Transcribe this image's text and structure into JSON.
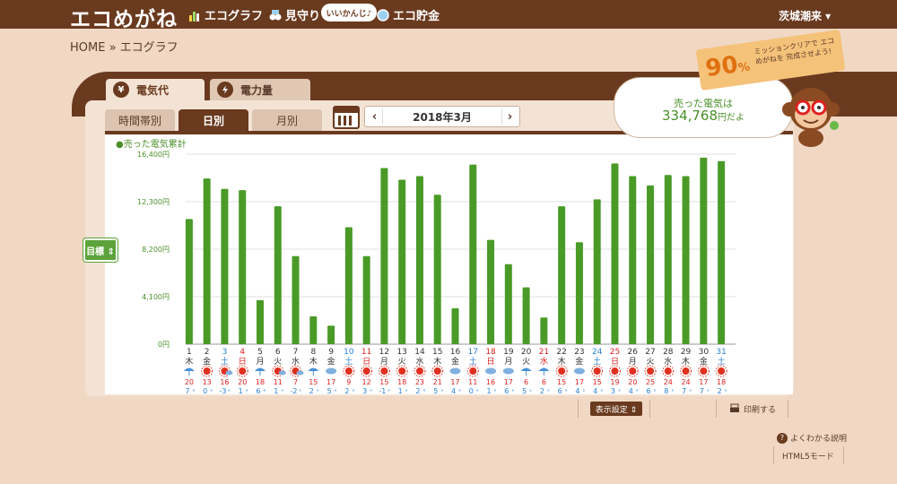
{
  "header": {
    "logo": "エコめがね",
    "nav": [
      {
        "label": "エコグラフ",
        "icon": "bar-chart-icon"
      },
      {
        "label": "見守り",
        "icon": "binoculars-icon"
      },
      {
        "label": "エコ貯金",
        "icon": "coin-icon"
      }
    ],
    "bubble": "いいかんじ♪",
    "user": "茨城潮来 ▾"
  },
  "breadcrumb": "HOME » エコグラフ",
  "tabs": {
    "cost_icon": "¥",
    "cost": "電気代",
    "power": "電力量",
    "hourly": "時間帯別",
    "daily": "日別",
    "monthly": "月別"
  },
  "month_label": "2018年3月",
  "prev_arrow": "‹",
  "next_arrow": "›",
  "sold": {
    "label": "売った電気は",
    "value": "334,768",
    "unit": "円だよ"
  },
  "mission": {
    "percent": "90",
    "percent_sign": "%",
    "message": "ミッションクリアで エコめがねを 完成させよう!"
  },
  "target_btn": "目標 ⇕",
  "display_settings": "表示設定 ⇕",
  "print": "印刷する",
  "help": "よくわかる説明",
  "html5": "HTML5モード",
  "chart_data": {
    "type": "bar",
    "legend": "●売った電気累計",
    "ylim": [
      0,
      16400
    ],
    "yticks": [
      "0円",
      "4,100円",
      "8,200円",
      "12,300円",
      "16,400円"
    ],
    "categories": [
      "1",
      "2",
      "3",
      "4",
      "5",
      "6",
      "7",
      "8",
      "9",
      "10",
      "11",
      "12",
      "13",
      "14",
      "15",
      "16",
      "17",
      "18",
      "19",
      "20",
      "21",
      "22",
      "23",
      "24",
      "25",
      "26",
      "27",
      "28",
      "29",
      "30",
      "31"
    ],
    "weekdays": [
      "木",
      "金",
      "土",
      "日",
      "月",
      "火",
      "水",
      "木",
      "金",
      "土",
      "日",
      "月",
      "火",
      "水",
      "木",
      "金",
      "土",
      "日",
      "月",
      "火",
      "水",
      "木",
      "金",
      "土",
      "日",
      "月",
      "火",
      "水",
      "木",
      "金",
      "土"
    ],
    "day_colors": [
      "#333",
      "#333",
      "#2a7fd4",
      "#e02020",
      "#333",
      "#333",
      "#333",
      "#333",
      "#333",
      "#2a7fd4",
      "#e02020",
      "#333",
      "#333",
      "#333",
      "#333",
      "#333",
      "#2a7fd4",
      "#e02020",
      "#333",
      "#333",
      "#e02020",
      "#333",
      "#333",
      "#2a7fd4",
      "#e02020",
      "#333",
      "#333",
      "#333",
      "#333",
      "#333",
      "#2a7fd4"
    ],
    "values": [
      10800,
      14300,
      13400,
      13300,
      3800,
      11900,
      7600,
      2400,
      1600,
      10100,
      7600,
      15200,
      14200,
      14500,
      12900,
      3100,
      15500,
      9000,
      6900,
      4900,
      2300,
      11900,
      8800,
      12500,
      15600,
      14500,
      13700,
      14600,
      14500,
      16100,
      15800
    ],
    "weather": [
      "rain",
      "sun",
      "sun-cloud",
      "sun",
      "rain",
      "sun-cloud",
      "sun-cloud",
      "rain",
      "cloud",
      "sun",
      "sun",
      "sun",
      "sun",
      "sun",
      "sun",
      "cloud",
      "sun",
      "cloud",
      "cloud",
      "rain-cloud",
      "rain",
      "sun",
      "cloud",
      "sun",
      "sun",
      "sun",
      "sun",
      "sun",
      "sun",
      "sun",
      "sun"
    ],
    "temp_high": [
      "20",
      "13",
      "16",
      "20",
      "18",
      "11",
      "7",
      "15",
      "17",
      "9",
      "12",
      "15",
      "18",
      "23",
      "21",
      "17",
      "11",
      "16",
      "17",
      "6",
      "6",
      "15",
      "17",
      "15",
      "19",
      "20",
      "25",
      "24",
      "24",
      "17",
      "18"
    ],
    "temp_low": [
      "7",
      "0",
      "-3",
      "1",
      "6",
      "1",
      "-2",
      "2",
      "5",
      "2",
      "3",
      "-1",
      "1",
      "2",
      "5",
      "4",
      "0",
      "1",
      "6",
      "5",
      "2",
      "6",
      "4",
      "4",
      "3",
      "4",
      "6",
      "8",
      "7",
      "7",
      "2"
    ],
    "bar_color": "#4a9a28"
  }
}
